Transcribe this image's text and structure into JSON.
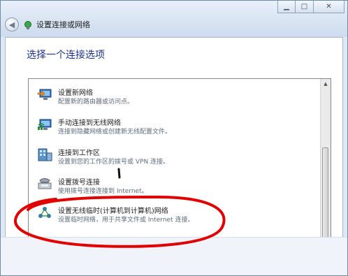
{
  "window": {
    "title": "设置连接或网络",
    "caption_buttons": {
      "minimize": "▁",
      "maximize": "□",
      "close": "✕"
    }
  },
  "main": {
    "heading": "选择一个连接选项",
    "options": [
      {
        "label": "设置新网络",
        "description": "配置新的路由器或访问点。",
        "icon": "new-network-icon"
      },
      {
        "label": "手动连接到无线网络",
        "description": "连接到隐藏网络或创建新无线配置文件。",
        "icon": "wireless-network-icon"
      },
      {
        "label": "连接到工作区",
        "description": "设置到您的工作区的拨号或 VPN 连接。",
        "icon": "workplace-icon"
      },
      {
        "label": "设置拨号连接",
        "description": "使用拨号连接连接到 Internet。",
        "icon": "dialup-modem-icon"
      },
      {
        "label": "设置无线临时(计算机到计算机)网络",
        "description": "设置临时网络，用于共享文件或 Internet 连接。",
        "icon": "adhoc-network-icon"
      }
    ]
  },
  "colors": {
    "heading": "#1e3287",
    "annotation": "#e00000"
  }
}
